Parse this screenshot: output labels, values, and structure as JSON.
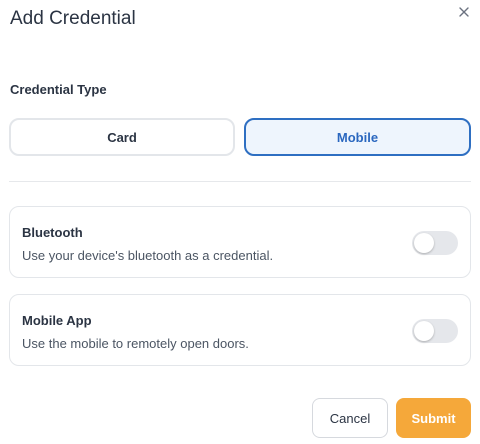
{
  "dialog": {
    "title": "Add Credential"
  },
  "icons": {
    "close": "close-icon"
  },
  "credential_type": {
    "label": "Credential Type",
    "options": [
      {
        "label": "Card",
        "selected": false
      },
      {
        "label": "Mobile",
        "selected": true
      }
    ]
  },
  "options": [
    {
      "title": "Bluetooth",
      "description": "Use your device's bluetooth as a credential.",
      "enabled": false
    },
    {
      "title": "Mobile App",
      "description": "Use the mobile to remotely open doors.",
      "enabled": false
    }
  ],
  "actions": {
    "cancel_label": "Cancel",
    "submit_label": "Submit"
  },
  "colors": {
    "accent": "#2e6fc2",
    "submit": "#f5a83a",
    "toggle_off": "#e5e7eb"
  }
}
